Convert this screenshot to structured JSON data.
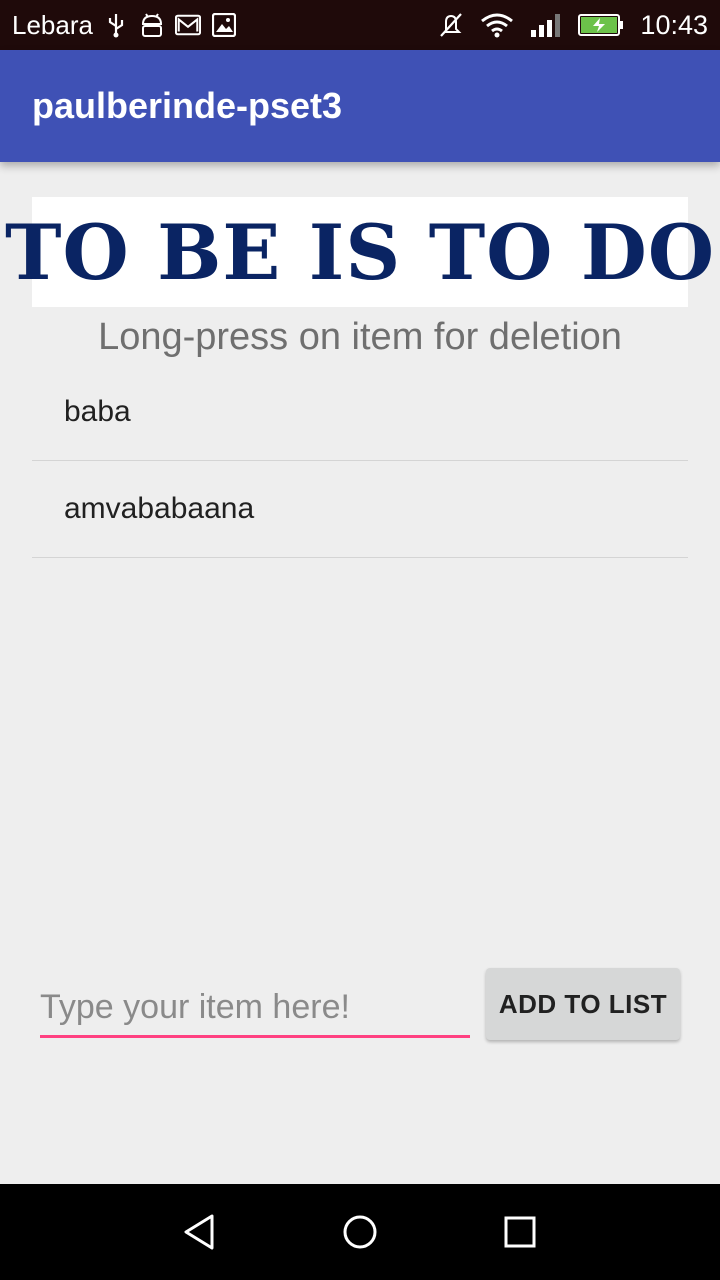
{
  "status_bar": {
    "carrier": "Lebara",
    "time": "10:43",
    "icons": [
      "usb-icon",
      "android-icon",
      "gmail-icon",
      "image-icon",
      "mute-icon",
      "wifi-icon",
      "signal-icon",
      "battery-charging-icon"
    ]
  },
  "app_bar": {
    "title": "paulberinde-pset3"
  },
  "banner": {
    "text": "TO BE IS TO DO"
  },
  "hint": {
    "text": "Long-press on item for deletion"
  },
  "todo_list": {
    "items": [
      {
        "label": "baba"
      },
      {
        "label": "amvababaana"
      }
    ]
  },
  "input": {
    "placeholder": "Type your item here!",
    "value": ""
  },
  "add_button": {
    "label": "ADD TO LIST"
  },
  "colors": {
    "app_bar": "#3f51b5",
    "accent": "#ff4081",
    "banner_text": "#0a2463",
    "background": "#eeeeee"
  },
  "nav_bar": {
    "icons": [
      "back-icon",
      "home-icon",
      "recents-icon"
    ]
  }
}
